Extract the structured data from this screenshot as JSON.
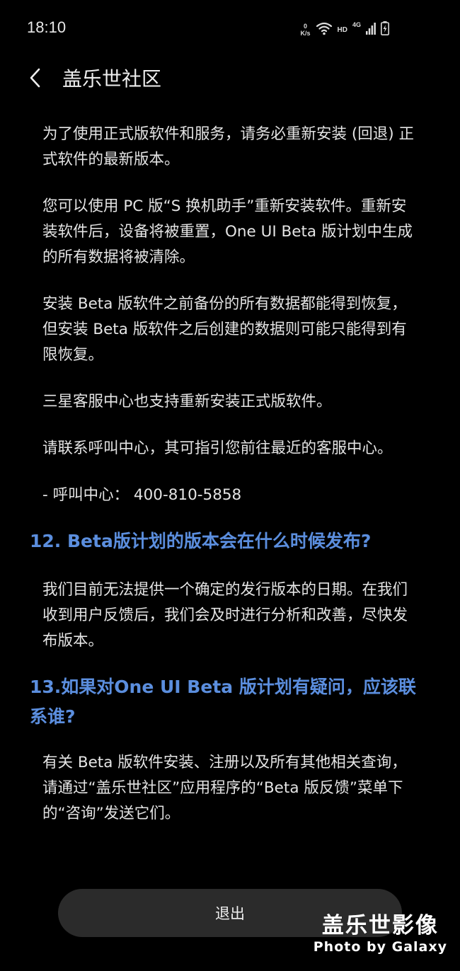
{
  "status_bar": {
    "time": "18:10",
    "net_speed_value": "0",
    "net_speed_unit": "K/s",
    "hd_label": "HD",
    "network_type": "4G"
  },
  "header": {
    "title": "盖乐世社区"
  },
  "content": {
    "paragraphs_1": [
      "为了使用正式版软件和服务，请务必重新安装 (回退) 正式软件的最新版本。",
      "您可以使用 PC 版“S 换机助手”重新安装软件。重新安装软件后，设备将被重置，One UI Beta 版计划中生成的所有数据将被清除。",
      "安装 Beta 版软件之前备份的所有数据都能得到恢复，但安装 Beta 版软件之后创建的数据则可能只能得到有限恢复。",
      "三星客服中心也支持重新安装正式版软件。",
      "请联系呼叫中心，其可指引您前往最近的客服中心。",
      "- 呼叫中心： 400-810-5858"
    ],
    "faq_12": {
      "question": "12. Beta版计划的版本会在什么时候发布?",
      "answer": "我们目前无法提供一个确定的发行版本的日期。在我们收到用户反馈后，我们会及时进行分析和改善，尽快发布版本。"
    },
    "faq_13": {
      "question": "13.如果对One UI Beta 版计划有疑问，应该联系谁?",
      "answer": "有关 Beta 版软件安装、注册以及所有其他相关查询，请通过“盖乐世社区”应用程序的“Beta 版反馈”菜单下的“咨询”发送它们。"
    }
  },
  "footer": {
    "exit_label": "退出"
  },
  "watermark": {
    "title": "盖乐世影像",
    "subtitle": "Photo by Galaxy"
  },
  "colors": {
    "background": "#000000",
    "text": "#e4e4e4",
    "accent_heading": "#5b8ede",
    "button_bg": "#2b2b2b"
  }
}
